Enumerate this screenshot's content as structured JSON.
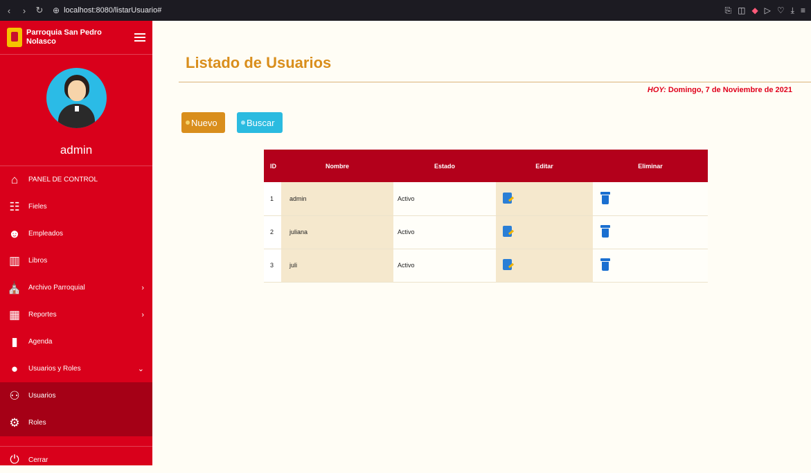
{
  "browser": {
    "url": "localhost:8080/listarUsuario#"
  },
  "sidebar": {
    "brand": "Parroquia San Pedro Nolasco",
    "username": "admin",
    "items": [
      {
        "label": "PANEL DE CONTROL",
        "icon": "home-icon"
      },
      {
        "label": "Fieles",
        "icon": "group-icon"
      },
      {
        "label": "Empleados",
        "icon": "employee-icon"
      },
      {
        "label": "Libros",
        "icon": "book-icon"
      },
      {
        "label": "Archivo Parroquial",
        "icon": "church-icon",
        "arrow": "›"
      },
      {
        "label": "Reportes",
        "icon": "chart-icon",
        "arrow": "›"
      },
      {
        "label": "Agenda",
        "icon": "agenda-icon"
      },
      {
        "label": "Usuarios y Roles",
        "icon": "user-icon",
        "arrow": "⌄"
      }
    ],
    "subitems": [
      {
        "label": "Usuarios",
        "icon": "users-icon"
      },
      {
        "label": "Roles",
        "icon": "roles-icon"
      }
    ],
    "logout": "Cerrar"
  },
  "main": {
    "title": "Listado de Usuarios",
    "date_prefix": "HOY:",
    "date": "Domingo, 7 de Noviembre de 2021",
    "new_button": "Nuevo",
    "search_button": "Buscar"
  },
  "table": {
    "headers": [
      "ID",
      "Nombre",
      "Estado",
      "Editar",
      "Eliminar"
    ],
    "rows": [
      {
        "id": "1",
        "name": "admin",
        "state": "Activo"
      },
      {
        "id": "2",
        "name": "juliana",
        "state": "Activo"
      },
      {
        "id": "3",
        "name": "juli",
        "state": "Activo"
      }
    ]
  },
  "colors": {
    "sidebar": "#d9001b",
    "submenu": "#a50016",
    "title": "#d98e1c",
    "table_header": "#b3001b",
    "search_button": "#2bbbe0"
  }
}
